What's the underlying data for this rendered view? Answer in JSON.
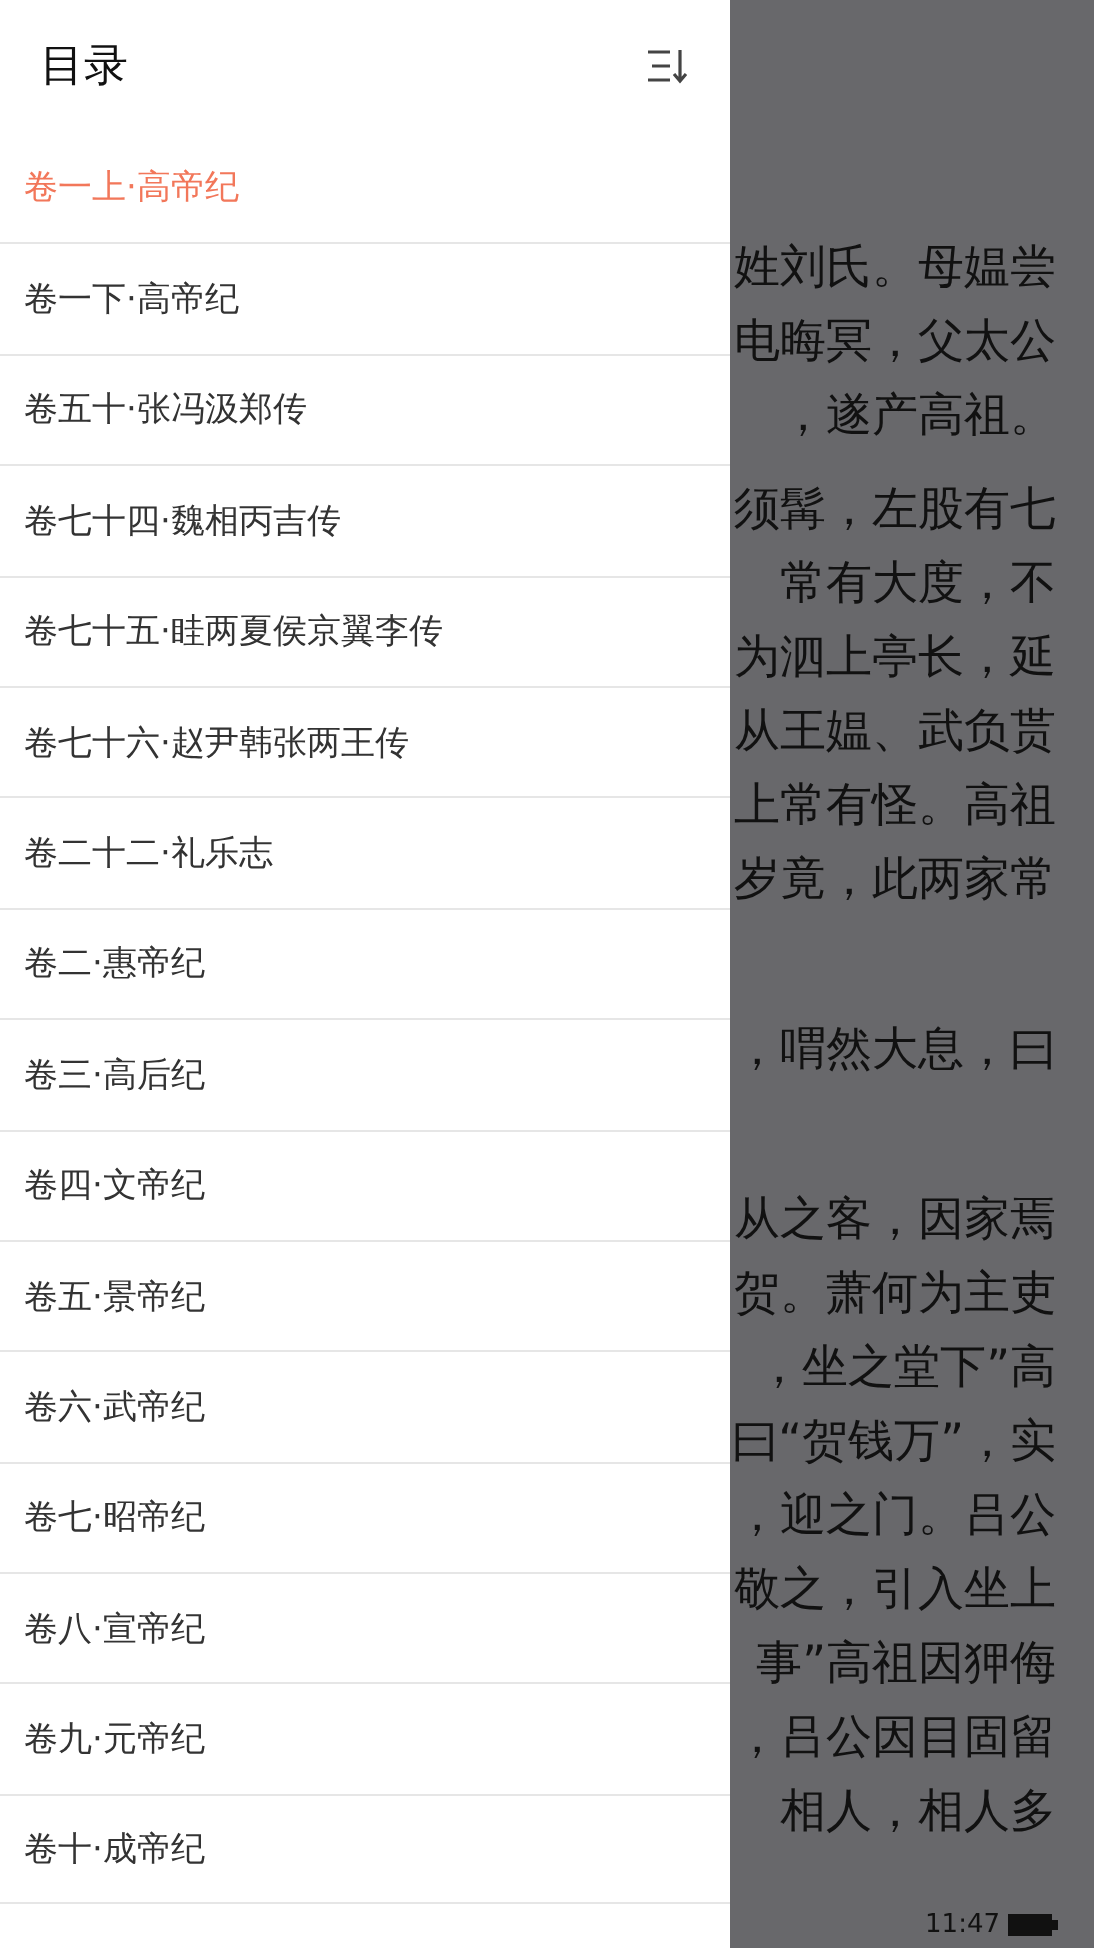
{
  "reader": {
    "paragraphs": [
      [
        "姓刘氏。母媪尝",
        "电晦冥，父太公",
        "，遂产高祖。"
      ],
      [
        "须髯，左股有七",
        "常有大度，不",
        "为泗上亭长，延",
        "从王媪、武负贳",
        "上常有怪。高祖",
        "岁竟，此两家常"
      ],
      [
        "，喟然大息，曰"
      ],
      [
        "从之客，因家焉",
        "贺。萧何为主吏",
        "，坐之堂下”高",
        "曰“贺钱万”，实",
        "，迎之门。吕公",
        "敬之，引入坐上",
        "事”高祖因狎侮",
        "，吕公因目固留",
        "相人，相人多"
      ]
    ]
  },
  "status_bar": {
    "time": "11:47"
  },
  "drawer": {
    "title": "目录",
    "items": [
      {
        "label": "卷一上·高帝纪",
        "selected": true
      },
      {
        "label": "卷一下·高帝纪",
        "selected": false
      },
      {
        "label": "卷五十·张冯汲郑传",
        "selected": false
      },
      {
        "label": "卷七十四·魏相丙吉传",
        "selected": false
      },
      {
        "label": "卷七十五·眭两夏侯京翼李传",
        "selected": false
      },
      {
        "label": "卷七十六·赵尹韩张两王传",
        "selected": false
      },
      {
        "label": "卷二十二·礼乐志",
        "selected": false
      },
      {
        "label": "卷二·惠帝纪",
        "selected": false
      },
      {
        "label": "卷三·高后纪",
        "selected": false
      },
      {
        "label": "卷四·文帝纪",
        "selected": false
      },
      {
        "label": "卷五·景帝纪",
        "selected": false
      },
      {
        "label": "卷六·武帝纪",
        "selected": false
      },
      {
        "label": "卷七·昭帝纪",
        "selected": false
      },
      {
        "label": "卷八·宣帝纪",
        "selected": false
      },
      {
        "label": "卷九·元帝纪",
        "selected": false
      },
      {
        "label": "卷十·成帝纪",
        "selected": false
      }
    ]
  }
}
